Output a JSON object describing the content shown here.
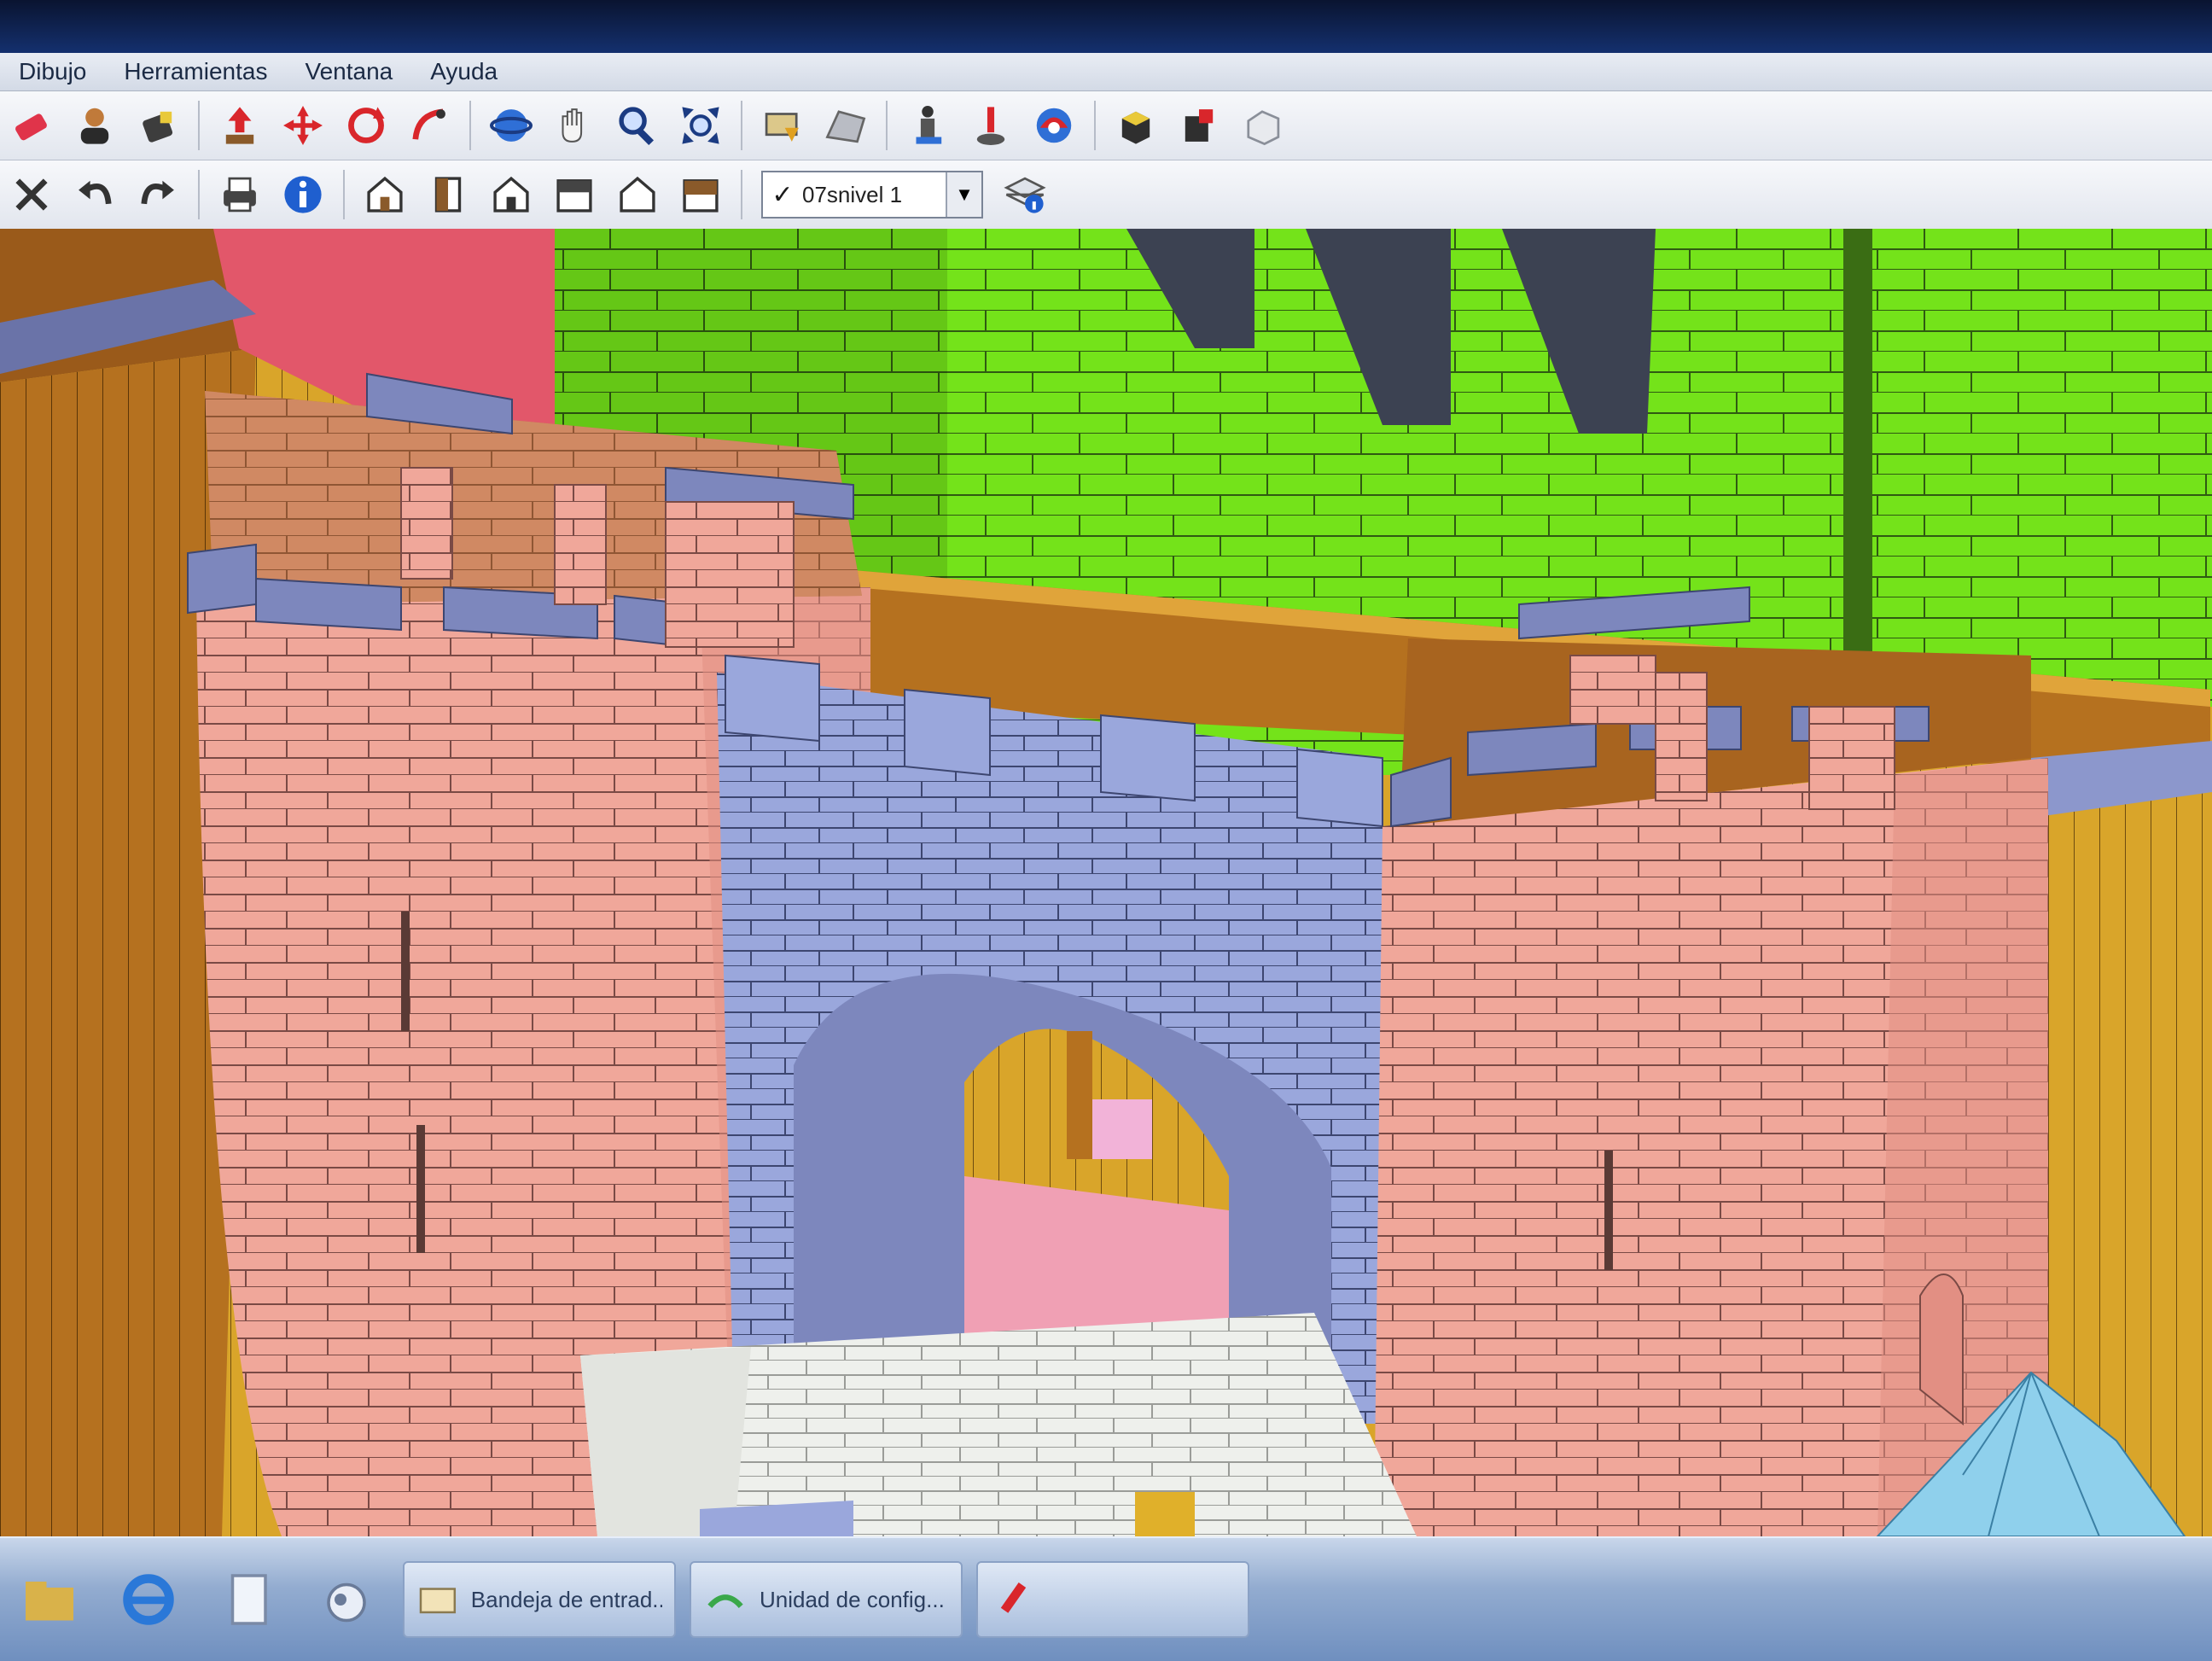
{
  "menu": {
    "items": [
      "Dibujo",
      "Herramientas",
      "Ventana",
      "Ayuda"
    ]
  },
  "toolbar1": {
    "icons": [
      "eraser-icon",
      "user-icon",
      "paint-bucket-icon",
      "push-pull-icon",
      "move-icon",
      "rotate-icon",
      "follow-me-icon",
      "orbit-icon",
      "pan-icon",
      "zoom-icon",
      "zoom-extents-icon",
      "add-location-icon",
      "terrain-icon",
      "walk-icon",
      "position-camera-icon",
      "look-around-icon",
      "components-icon",
      "warehouse-icon",
      "extension-icon"
    ]
  },
  "toolbar2": {
    "icons": [
      "delete-icon",
      "undo-icon",
      "redo-icon",
      "print-icon",
      "model-info-icon",
      "iso-view-icon",
      "top-view-icon",
      "front-view-icon",
      "right-view-icon",
      "back-view-icon",
      "left-view-icon"
    ],
    "layer_selected": "07snivel 1",
    "layer_check": "✓"
  },
  "taskbar": {
    "buttons": [
      {
        "label": "Bandeja de entrad..."
      },
      {
        "label": "Unidad de config..."
      },
      {
        "label": ""
      }
    ]
  },
  "colors": {
    "pink_wall": "#f0a79a",
    "blue_stone": "#9aa7dc",
    "green_wall": "#74e31a",
    "floor": "#d9a52a",
    "dark_brown": "#9a5a1a"
  }
}
